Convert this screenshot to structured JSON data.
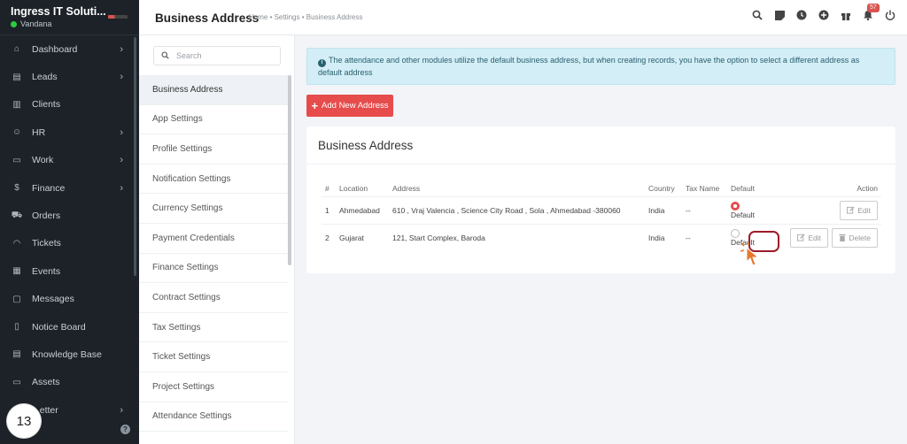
{
  "brand": {
    "name": "Ingress IT Soluti...",
    "user": "Vandana"
  },
  "sidebar": {
    "items": [
      {
        "label": "Dashboard",
        "icon": "home-icon",
        "chevron": true
      },
      {
        "label": "Leads",
        "icon": "id-card-icon",
        "chevron": true
      },
      {
        "label": "Clients",
        "icon": "building-icon",
        "chevron": false
      },
      {
        "label": "HR",
        "icon": "people-icon",
        "chevron": true
      },
      {
        "label": "Work",
        "icon": "briefcase-icon",
        "chevron": true
      },
      {
        "label": "Finance",
        "icon": "dollar-icon",
        "chevron": true
      },
      {
        "label": "Orders",
        "icon": "cart-icon",
        "chevron": false
      },
      {
        "label": "Tickets",
        "icon": "headset-icon",
        "chevron": false
      },
      {
        "label": "Events",
        "icon": "calendar-icon",
        "chevron": false
      },
      {
        "label": "Messages",
        "icon": "chat-icon",
        "chevron": false
      },
      {
        "label": "Notice Board",
        "icon": "clipboard-icon",
        "chevron": false
      },
      {
        "label": "Knowledge Base",
        "icon": "book-icon",
        "chevron": false
      },
      {
        "label": "Assets",
        "icon": "monitor-icon",
        "chevron": false
      },
      {
        "label": "...etter",
        "icon": "letter-icon",
        "chevron": true
      }
    ],
    "step_badge": "13"
  },
  "header": {
    "title": "Business Address",
    "breadcrumb": "Home • Settings • Business Address",
    "notification_count": "57"
  },
  "settings_menu": {
    "search_placeholder": "Search",
    "items": [
      "Business Address",
      "App Settings",
      "Profile Settings",
      "Notification Settings",
      "Currency Settings",
      "Payment Credentials",
      "Finance Settings",
      "Contract Settings",
      "Tax Settings",
      "Ticket Settings",
      "Project Settings",
      "Attendance Settings"
    ]
  },
  "main": {
    "alert": "The attendance and other modules utilize the default business address, but when creating records, you have the option to select a different address as default address",
    "add_button": "Add New Address",
    "card_title": "Business Address",
    "columns": [
      "#",
      "Location",
      "Address",
      "Country",
      "Tax Name",
      "Default",
      "Action"
    ],
    "rows": [
      {
        "num": "1",
        "location": "Ahmedabad",
        "address": "610 , Vraj Valencia , Science City Road , Sola , Ahmedabad -380060",
        "country": "India",
        "tax": "--",
        "default_label": "Default",
        "is_default": true
      },
      {
        "num": "2",
        "location": "Gujarat",
        "address": "121, Start Complex, Baroda",
        "country": "India",
        "tax": "--",
        "default_label": "Default",
        "is_default": false
      }
    ],
    "edit_label": "Edit",
    "delete_label": "Delete"
  },
  "colors": {
    "accent": "#e74c4c",
    "sidebar_bg": "#1d2228",
    "alert_bg": "#d3eef6"
  }
}
